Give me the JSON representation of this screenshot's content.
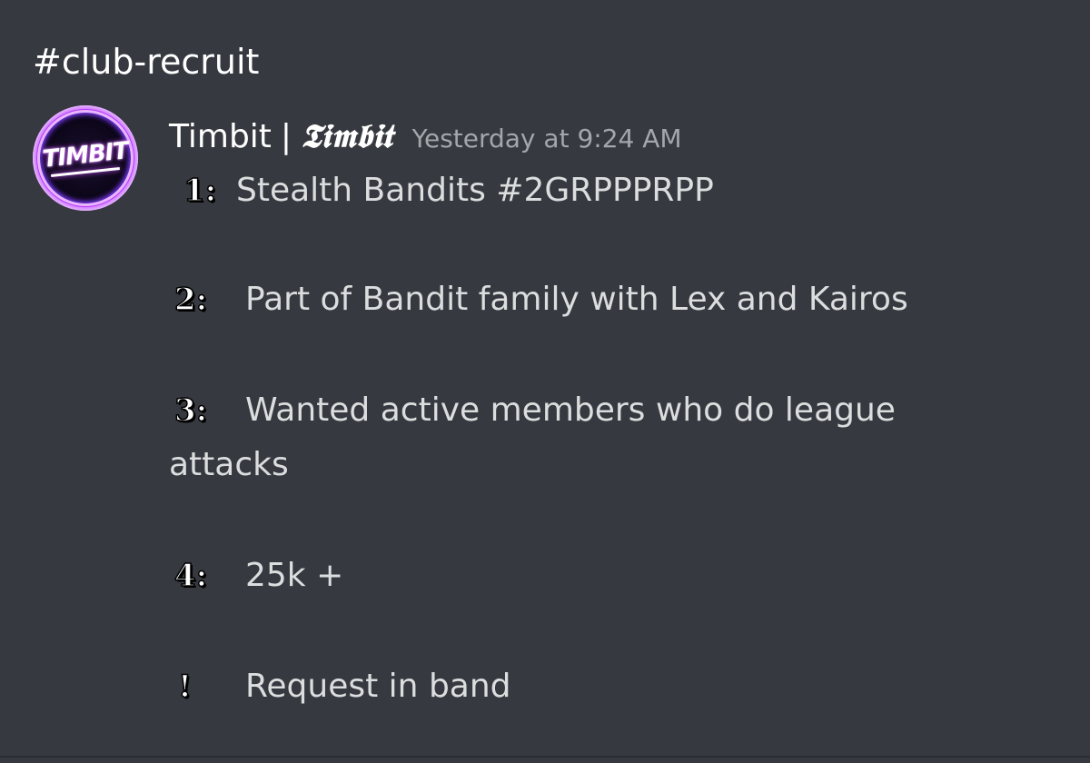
{
  "channel": {
    "name": "#club-recruit"
  },
  "message": {
    "avatar_icon": "timbit-logo-avatar",
    "avatar_text": "TIMBIT",
    "author_name": "Timbit",
    "author_separator": "|",
    "author_fancy": "𝕿𝖎𝖒𝖇𝖎𝖙",
    "timestamp": "Yesterday at 9:24 AM",
    "lines": [
      {
        "bullet": "1:",
        "text": "Stealth Bandits #2GRPPPRPP"
      },
      {
        "bullet": "2:",
        "text": "Part of Bandit family with Lex and Kairos"
      },
      {
        "bullet": "3:",
        "text": "Wanted active members who do league"
      },
      {
        "bullet": "",
        "text": "attacks"
      },
      {
        "bullet": "4:",
        "text": "25k +"
      },
      {
        "bullet": "!",
        "text": "Request in band"
      }
    ]
  },
  "colors": {
    "background": "#36393f",
    "username": "#ffffff",
    "timestamp": "#a3a6aa",
    "text": "#dcddde",
    "avatar_glow": "#c84cff"
  }
}
